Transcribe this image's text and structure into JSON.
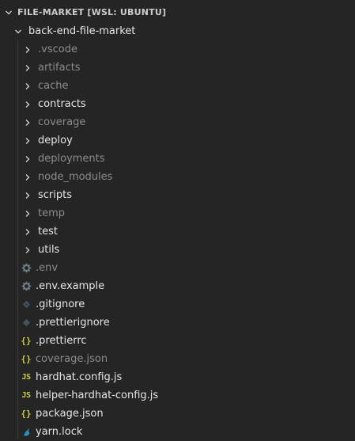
{
  "explorer": {
    "root_label": "FILE-MARKET [WSL: UBUNTU]",
    "project_label": "back-end-file-market",
    "folders": [
      {
        "label": ".vscode",
        "dim": true
      },
      {
        "label": "artifacts",
        "dim": true
      },
      {
        "label": "cache",
        "dim": true
      },
      {
        "label": "contracts",
        "dim": false
      },
      {
        "label": "coverage",
        "dim": true
      },
      {
        "label": "deploy",
        "dim": false
      },
      {
        "label": "deployments",
        "dim": true
      },
      {
        "label": "node_modules",
        "dim": true
      },
      {
        "label": "scripts",
        "dim": false
      },
      {
        "label": "temp",
        "dim": true
      },
      {
        "label": "test",
        "dim": false
      },
      {
        "label": "utils",
        "dim": false
      }
    ],
    "files": [
      {
        "label": ".env",
        "icon": "gear-icon",
        "dim": true
      },
      {
        "label": ".env.example",
        "icon": "gear-icon",
        "dim": false
      },
      {
        "label": ".gitignore",
        "icon": "git-icon",
        "dim": false
      },
      {
        "label": ".prettierignore",
        "icon": "diamond-icon",
        "dim": false
      },
      {
        "label": ".prettierrc",
        "icon": "json-icon",
        "dim": false
      },
      {
        "label": "coverage.json",
        "icon": "json-icon",
        "dim": true
      },
      {
        "label": "hardhat.config.js",
        "icon": "js-icon",
        "dim": false
      },
      {
        "label": "helper-hardhat-config.js",
        "icon": "js-icon",
        "dim": false
      },
      {
        "label": "package.json",
        "icon": "json-icon",
        "dim": false
      },
      {
        "label": "yarn.lock",
        "icon": "yarn-icon",
        "dim": false
      }
    ]
  },
  "colors": {
    "background": "#252526",
    "text": "#cccccc",
    "text_bright": "#e6e6e6",
    "text_dim": "#8c8c8c",
    "js_icon": "#cbcb41",
    "json_icon": "#cbcb41",
    "gear_icon": "#6d8086",
    "yarn_icon": "#2c8ebb"
  }
}
